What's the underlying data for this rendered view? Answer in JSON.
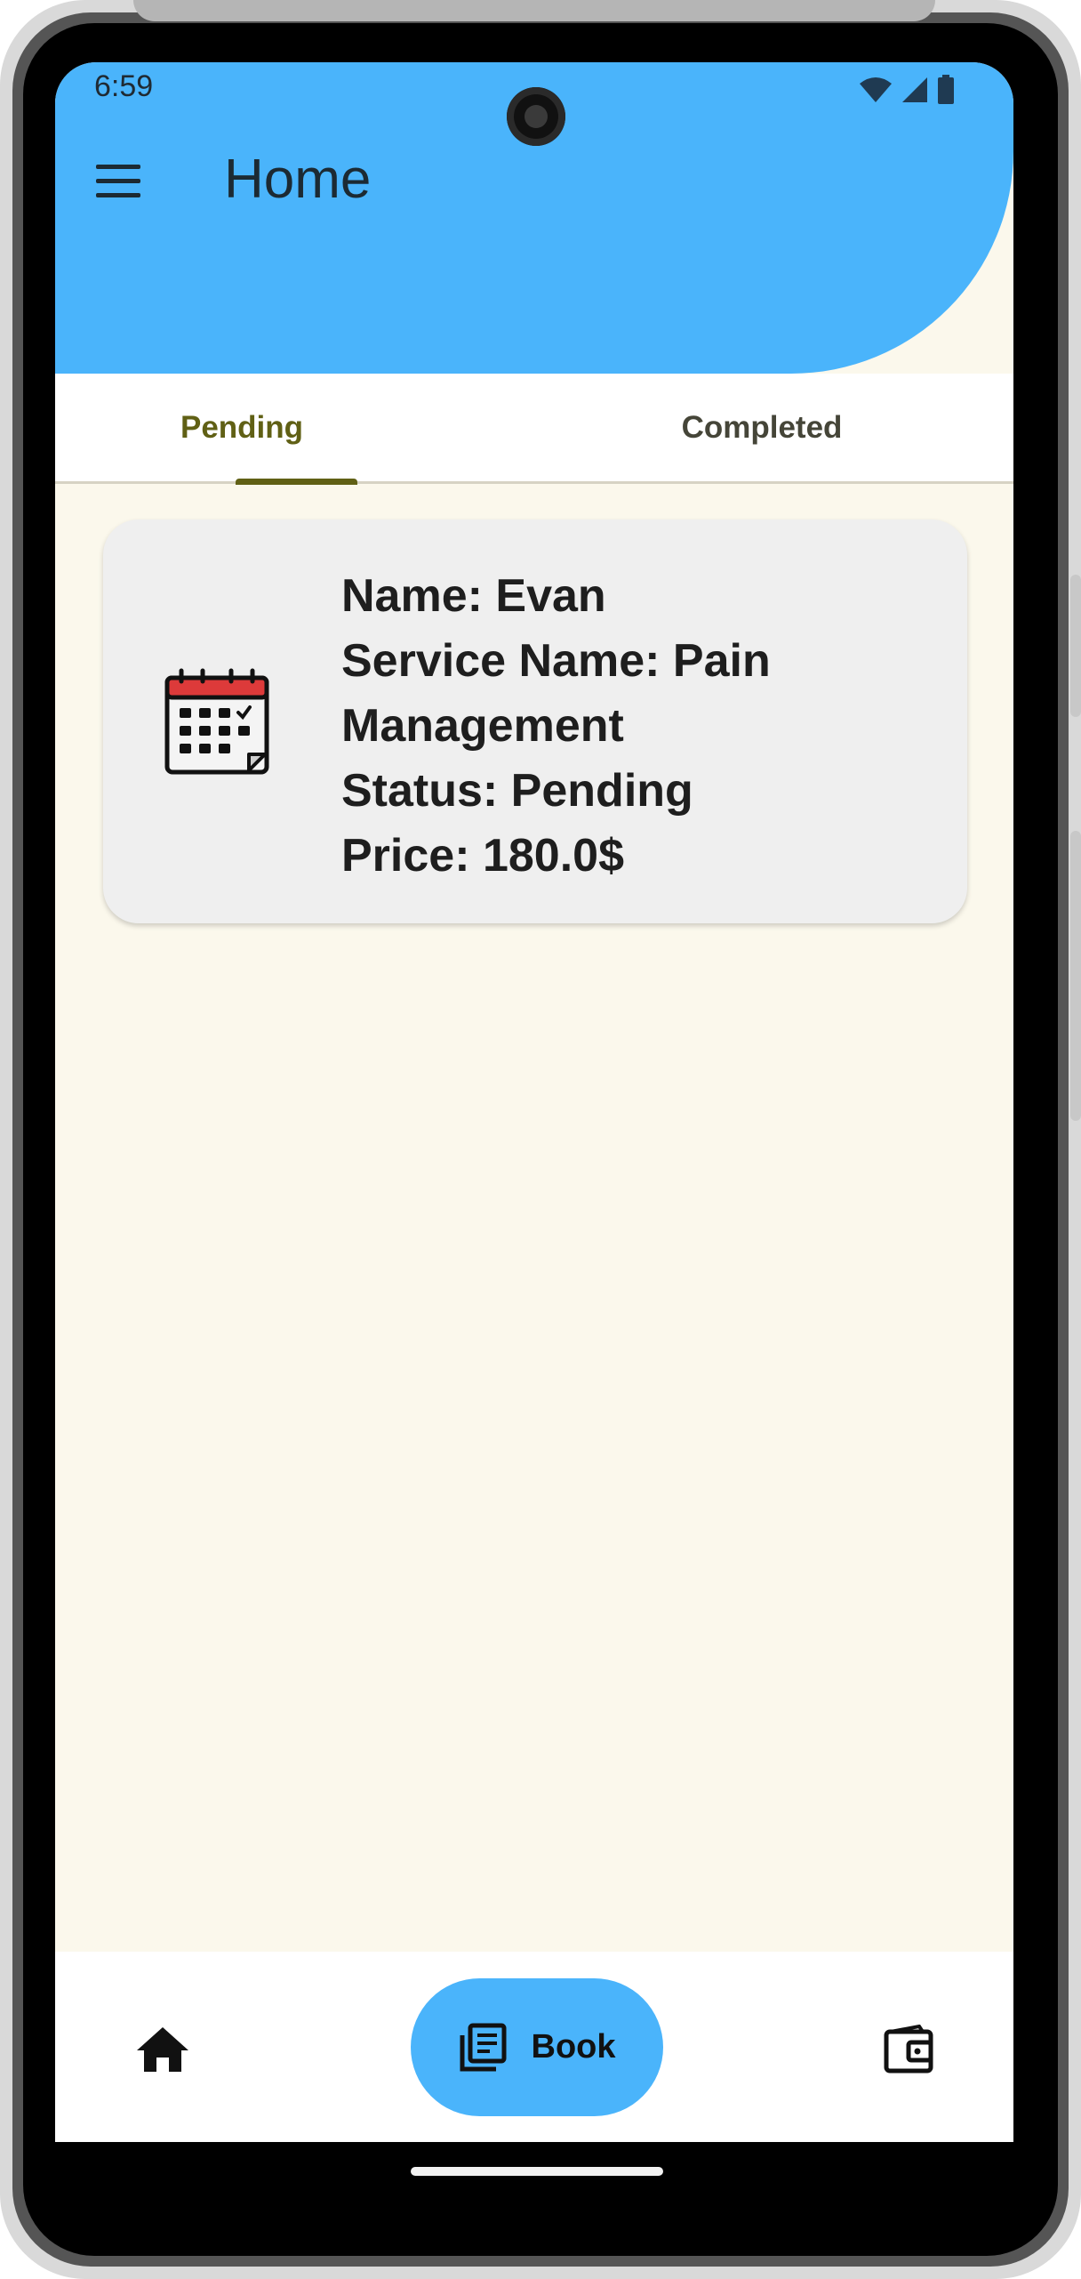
{
  "status_bar": {
    "time": "6:59",
    "icons": [
      "wifi-icon",
      "signal-icon",
      "battery-icon"
    ]
  },
  "header": {
    "title": "Home",
    "menu_icon": "menu-icon",
    "color": "#4ab4fb"
  },
  "tabs": [
    {
      "label": "Pending",
      "selected": true
    },
    {
      "label": "Completed",
      "selected": false
    }
  ],
  "appointments": [
    {
      "icon": "calendar-icon",
      "lines": [
        "Name: Evan",
        "Service Name: Pain",
        "Management",
        "Status: Pending",
        "Price: 180.0$"
      ]
    }
  ],
  "bottom_nav": {
    "home_icon": "home-icon",
    "book_label": "Book",
    "book_icon": "book-list-icon",
    "wallet_icon": "wallet-icon"
  },
  "colors": {
    "accent": "#4ab4fb",
    "tab_selected": "#606015",
    "background": "#fbf8ec",
    "card": "#efefef"
  }
}
